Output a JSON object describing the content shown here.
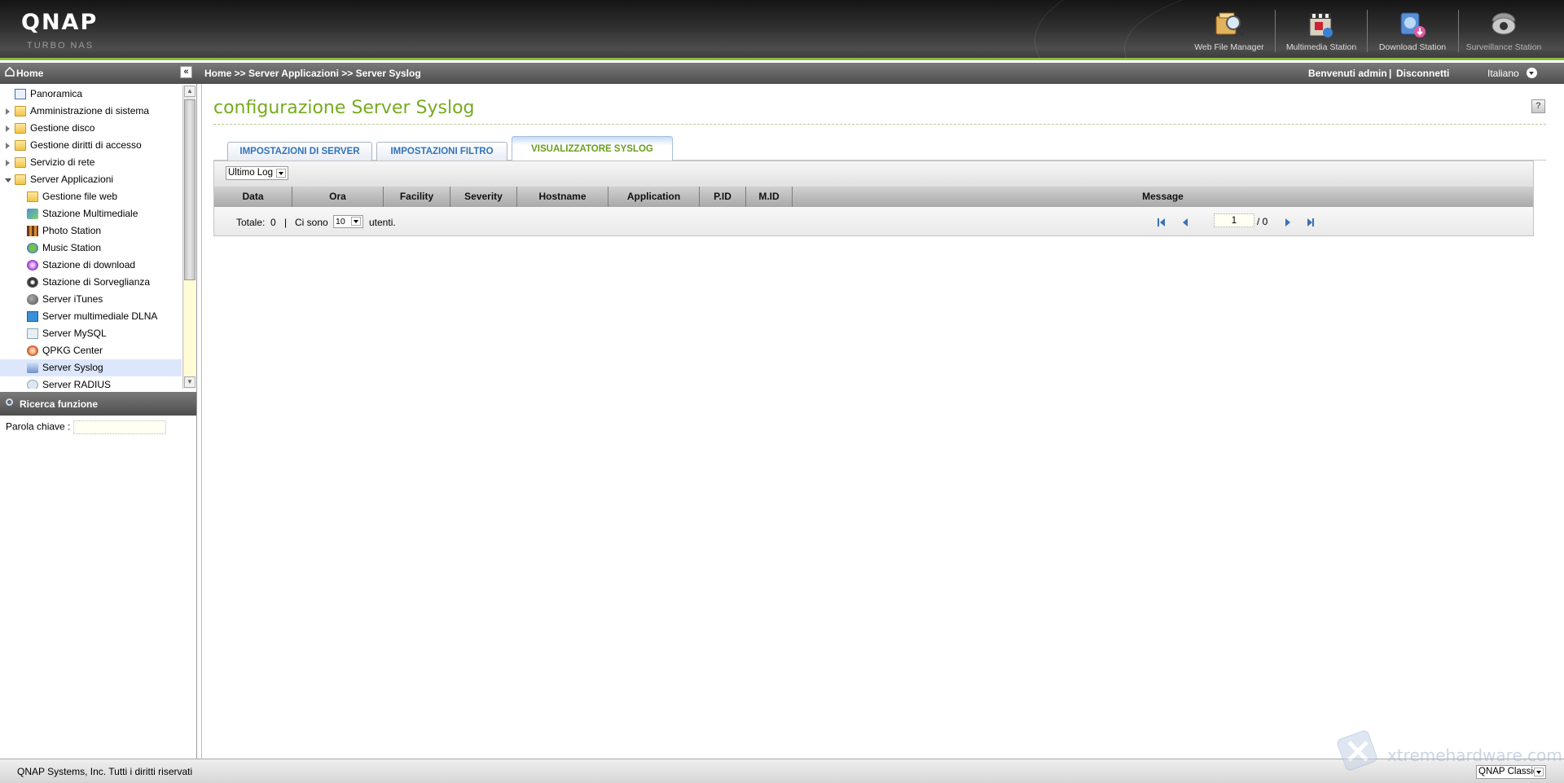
{
  "header": {
    "logo": "QNAP",
    "logo_sub": "TURBO NAS",
    "apps": [
      {
        "label": "Web File Manager",
        "icon": "web-file-manager-icon"
      },
      {
        "label": "Multimedia Station",
        "icon": "multimedia-station-icon"
      },
      {
        "label": "Download Station",
        "icon": "download-station-icon"
      },
      {
        "label": "Surveillance Station",
        "icon": "surveillance-station-icon"
      }
    ]
  },
  "topbar": {
    "home_label": "Home",
    "breadcrumb": "Home >> Server Applicazioni >> Server Syslog",
    "welcome": "Benvenuti admin",
    "separator": "|",
    "logout": "Disconnetti",
    "language": "Italiano"
  },
  "sidebar": {
    "tree": [
      {
        "label": "Panoramica",
        "icon": "overview-icon",
        "level": 0,
        "expander": "none"
      },
      {
        "label": "Amministrazione di sistema",
        "icon": "folder-icon",
        "level": 0,
        "expander": "closed"
      },
      {
        "label": "Gestione disco",
        "icon": "folder-icon",
        "level": 0,
        "expander": "closed"
      },
      {
        "label": "Gestione diritti di accesso",
        "icon": "folder-icon",
        "level": 0,
        "expander": "closed"
      },
      {
        "label": "Servizio di rete",
        "icon": "folder-icon",
        "level": 0,
        "expander": "closed"
      },
      {
        "label": "Server Applicazioni",
        "icon": "folder-open-icon",
        "level": 0,
        "expander": "open"
      },
      {
        "label": "Gestione file web",
        "icon": "folder-icon",
        "level": 1
      },
      {
        "label": "Stazione Multimediale",
        "icon": "multimedia-icon",
        "level": 1
      },
      {
        "label": "Photo Station",
        "icon": "photo-station-icon",
        "level": 1
      },
      {
        "label": "Music Station",
        "icon": "music-station-icon",
        "level": 1
      },
      {
        "label": "Stazione di download",
        "icon": "download-icon",
        "level": 1
      },
      {
        "label": "Stazione di Sorveglianza",
        "icon": "surveillance-icon",
        "level": 1
      },
      {
        "label": "Server iTunes",
        "icon": "itunes-icon",
        "level": 1
      },
      {
        "label": "Server multimediale DLNA",
        "icon": "dlna-icon",
        "level": 1
      },
      {
        "label": "Server MySQL",
        "icon": "mysql-icon",
        "level": 1
      },
      {
        "label": "QPKG Center",
        "icon": "qpkg-icon",
        "level": 1
      },
      {
        "label": "Server Syslog",
        "icon": "syslog-icon",
        "level": 1,
        "selected": true
      },
      {
        "label": "Server RADIUS",
        "icon": "radius-icon",
        "level": 1
      }
    ],
    "search": {
      "title": "Ricerca funzione",
      "keyword_label": "Parola chiave :",
      "keyword_value": ""
    }
  },
  "main": {
    "title": "configurazione Server Syslog",
    "tabs": [
      {
        "label": "IMPOSTAZIONI DI SERVER",
        "active": false
      },
      {
        "label": "IMPOSTAZIONI FILTRO",
        "active": false
      },
      {
        "label": "VISUALIZZATORE SYSLOG",
        "active": true
      }
    ],
    "log_select": "Ultimo Log",
    "columns": [
      "Data",
      "Ora",
      "Facility",
      "Severity",
      "Hostname",
      "Application",
      "P.ID",
      "M.ID",
      "Message"
    ],
    "rows": [],
    "footer": {
      "total_label": "Totale:",
      "total_value": "0",
      "sep": "|",
      "ci_sono": "Ci sono",
      "per_page": "10",
      "utenti": "utenti.",
      "page": "1",
      "of_pages": "/ 0"
    }
  },
  "statusbar": {
    "copyright": "QNAP Systems, Inc. Tutti i diritti riservati",
    "theme": "QNAP Classic",
    "watermark": "xtremehardware.com"
  },
  "colors": {
    "accent_green": "#76ab1e",
    "tab_blue": "#3173b8",
    "header_dark": "#2e2e2e",
    "selection": "#dde7fb"
  }
}
